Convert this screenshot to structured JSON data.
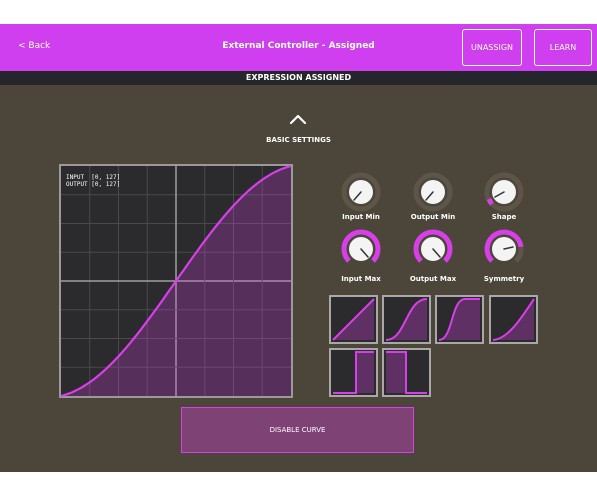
{
  "header": {
    "back_label": "< Back",
    "title": "External Controller - Assigned",
    "unassign_label": "UNASSIGN",
    "learn_label": "LEARN"
  },
  "status": {
    "text": "EXPRESSION ASSIGNED"
  },
  "section": {
    "title": "BASIC SETTINGS",
    "collapse_icon": "chevron-up-icon"
  },
  "graph": {
    "input_range": "INPUT  [0, 127]",
    "output_range": "OUTPUT [0, 127]"
  },
  "knobs": [
    {
      "label": "Input Min",
      "level": 0.0
    },
    {
      "label": "Output Min",
      "level": 0.0
    },
    {
      "label": "Shape",
      "level": 0.1
    },
    {
      "label": "Input Max",
      "level": 1.0
    },
    {
      "label": "Output Max",
      "level": 1.0
    },
    {
      "label": "Symmetry",
      "level": 0.6
    }
  ],
  "presets": [
    "linear",
    "s-curve",
    "steep-s-curve",
    "exponential",
    "step-up",
    "step-down"
  ],
  "footer": {
    "disable_label": "DISABLE CURVE"
  },
  "colors": {
    "accent": "#cf3ff0",
    "background": "#4c453a",
    "status_bar": "#25262c",
    "curve": "#d73fe8",
    "button_fill": "#7e4275"
  }
}
